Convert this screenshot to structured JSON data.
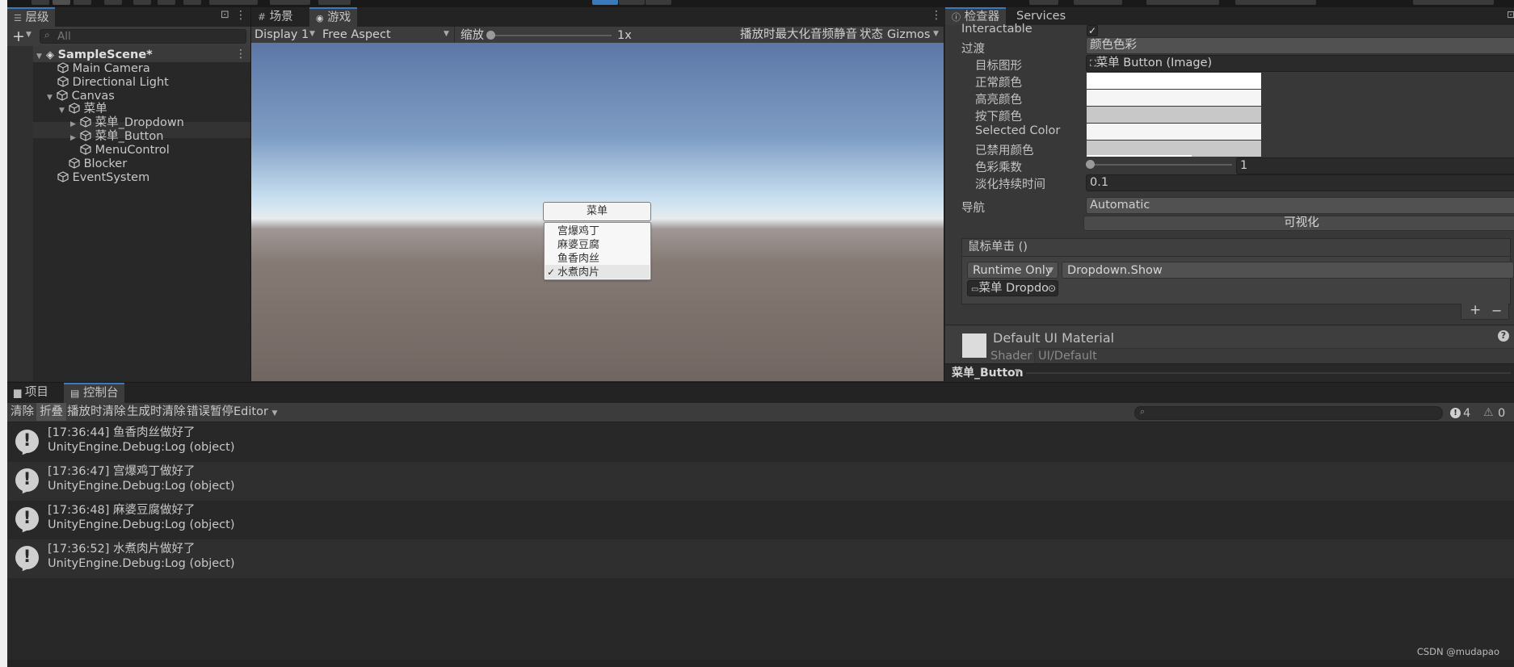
{
  "hierarchy": {
    "tab_label": "层级",
    "search_placeholder": "All",
    "add_label": "+",
    "items": [
      {
        "label": "SampleScene*"
      },
      {
        "label": "Main Camera"
      },
      {
        "label": "Directional Light"
      },
      {
        "label": "Canvas"
      },
      {
        "label": "菜单"
      },
      {
        "label": "菜单_Dropdown"
      },
      {
        "label": "菜单_Button"
      },
      {
        "label": "MenuControl"
      },
      {
        "label": "Blocker"
      },
      {
        "label": "EventSystem"
      }
    ]
  },
  "game_view": {
    "tabs": [
      {
        "label": "场景"
      },
      {
        "label": "游戏"
      }
    ],
    "display": "Display 1",
    "aspect": "Free Aspect",
    "scale_label": "缩放",
    "scale_value": "1x",
    "scale_level": 0,
    "maximize_label": "播放时最大化",
    "mute_label": "音频静音",
    "stats_label": "状态",
    "gizmos_label": "Gizmos",
    "menu_button": "菜单",
    "dropdown_items": [
      "宫爆鸡丁",
      "麻婆豆腐",
      "鱼香肉丝",
      "水煮肉片"
    ],
    "selected_check": "✓"
  },
  "inspector": {
    "tabs": [
      {
        "label": "检查器"
      },
      {
        "label": "Services"
      }
    ],
    "interactable_label": "Interactable",
    "interactable_check": "✓",
    "transition_label": "过渡",
    "transition_value": "颜色色彩",
    "target_graphic_label": "目标图形",
    "target_graphic_value": "菜单 Button (Image)",
    "normal_color_label": "正常颜色",
    "highlight_color_label": "高亮颜色",
    "pressed_color_label": "按下颜色",
    "selected_color_label": "Selected Color",
    "disabled_color_label": "已禁用颜色",
    "color_multiplier_label": "色彩乘数",
    "color_multiplier_value": "1",
    "fade_duration_label": "淡化持续时间",
    "fade_duration_value": "0.1",
    "navigation_label": "导航",
    "navigation_value": "Automatic",
    "visualize_label": "可视化",
    "onclick_label": "鼠标单击 ()",
    "runtime_value": "Runtime Only",
    "function_value": "Dropdown.Show",
    "object_value": "菜单 Dropdo",
    "add_symbol": "+",
    "remove_symbol": "−",
    "material_name": "Default UI Material",
    "shader_label": "Shader",
    "shader_value": "UI/Default",
    "help_symbol": "?",
    "footer_object": "菜单_Button"
  },
  "console": {
    "tabs": [
      {
        "label": "项目"
      },
      {
        "label": "控制台"
      }
    ],
    "toolbar": {
      "clear": "清除",
      "collapse": "折叠",
      "clear_on_play": "播放时清除",
      "clear_on_build": "生成时清除",
      "error_pause": "错误暂停",
      "editor": "Editor"
    },
    "info_count": "4",
    "warn_count": "0",
    "logs": [
      {
        "line1": "[17:36:44] 鱼香肉丝做好了",
        "line2": "UnityEngine.Debug:Log (object)"
      },
      {
        "line1": "[17:36:47] 宫爆鸡丁做好了",
        "line2": "UnityEngine.Debug:Log (object)"
      },
      {
        "line1": "[17:36:48] 麻婆豆腐做好了",
        "line2": "UnityEngine.Debug:Log (object)"
      },
      {
        "line1": "[17:36:52] 水煮肉片做好了",
        "line2": "UnityEngine.Debug:Log (object)"
      }
    ]
  },
  "watermark": "CSDN @mudapao",
  "colors": {
    "accent": "#3a79bb",
    "panel": "#282828",
    "panel_light": "#383838",
    "sky_top": "#5c77a6",
    "horizon": "#e7ecef",
    "ground": "#6f6460"
  }
}
